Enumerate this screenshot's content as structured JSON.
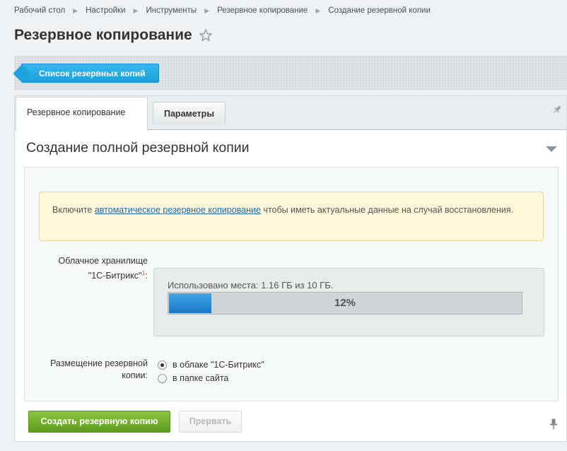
{
  "breadcrumb": {
    "items": [
      "Рабочий стол",
      "Настройки",
      "Инструменты",
      "Резервное копирование",
      "Создание резервной копии"
    ]
  },
  "page": {
    "title": "Резервное копирование"
  },
  "toolbar": {
    "list_button": "Список резервных копий"
  },
  "tabs": [
    {
      "label": "Резервное копирование",
      "active": true
    },
    {
      "label": "Параметры",
      "active": false
    }
  ],
  "section": {
    "title": "Создание полной резервной копии"
  },
  "notice": {
    "prefix": "Включите ",
    "link": "автоматическое резервное копирование",
    "suffix": " чтобы иметь актуальные данные на случай восстановления."
  },
  "storage": {
    "label_line1": "Облачное хранилище",
    "label_line2": "\"1С-Битрикс\"",
    "label_sup": "1",
    "label_colon": ":",
    "usage_text": "Использовано места: 1.16 ГБ из 10 ГБ.",
    "progress_text": "12%",
    "progress_fraction": 0.12
  },
  "placement": {
    "label_line1": "Размещение резервной",
    "label_line2": "копии:",
    "options": [
      {
        "label": "в облаке \"1С-Битрикс\"",
        "checked": true
      },
      {
        "label": "в папке сайта",
        "checked": false
      }
    ]
  },
  "actions": {
    "create": "Создать резервную копию",
    "abort": "Прервать"
  },
  "colors": {
    "accent_blue": "#1b9fdb",
    "create_green": "#5d9b1f",
    "progress_blue": "#1b75c8"
  },
  "icons": {
    "star": "star-icon",
    "pin": "pin-icon",
    "collapse": "chevron-down-icon"
  }
}
